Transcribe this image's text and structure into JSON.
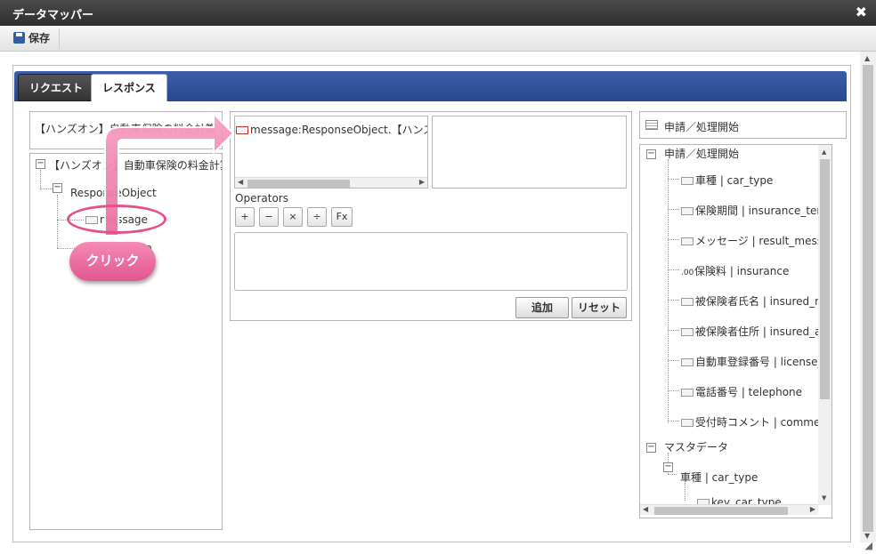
{
  "window": {
    "title": "データマッパー",
    "close": "✖"
  },
  "toolbar": {
    "save_label": "保存"
  },
  "tabs": [
    {
      "label": "リクエスト"
    },
    {
      "label": "レスポンス"
    }
  ],
  "left": {
    "selector_text": "【ハンズオン】自動車保険の料金計算",
    "tree": {
      "root": "【ハンズオン】自動車保険の料金計算",
      "child": "ResponseObject",
      "items": [
        "message",
        "insurance"
      ]
    }
  },
  "middle": {
    "expression_item": "message:ResponseObject.【ハンズオン】自動車保険の料金計算",
    "operators_label": "Operators",
    "operators": [
      "+",
      "−",
      "×",
      "÷",
      "Fx"
    ],
    "add_label": "追加",
    "reset_label": "リセット"
  },
  "right": {
    "header": "申請／処理開始",
    "groups": [
      {
        "label": "申請／処理開始",
        "items": [
          "車種 | car_type",
          "保険期間 | insurance_term",
          "メッセージ | result_message",
          "保険料 | insurance",
          "被保険者氏名 | insured_name",
          "被保険者住所 | insured_address",
          "自動車登録番号 | license_plate",
          "電話番号 | telephone",
          "受付時コメント | comment"
        ]
      },
      {
        "label": "マスタデータ",
        "subgroup": "車種 | car_type",
        "subitems": [
          "key_car_type"
        ]
      }
    ]
  },
  "annotation": {
    "callout": "クリック"
  }
}
